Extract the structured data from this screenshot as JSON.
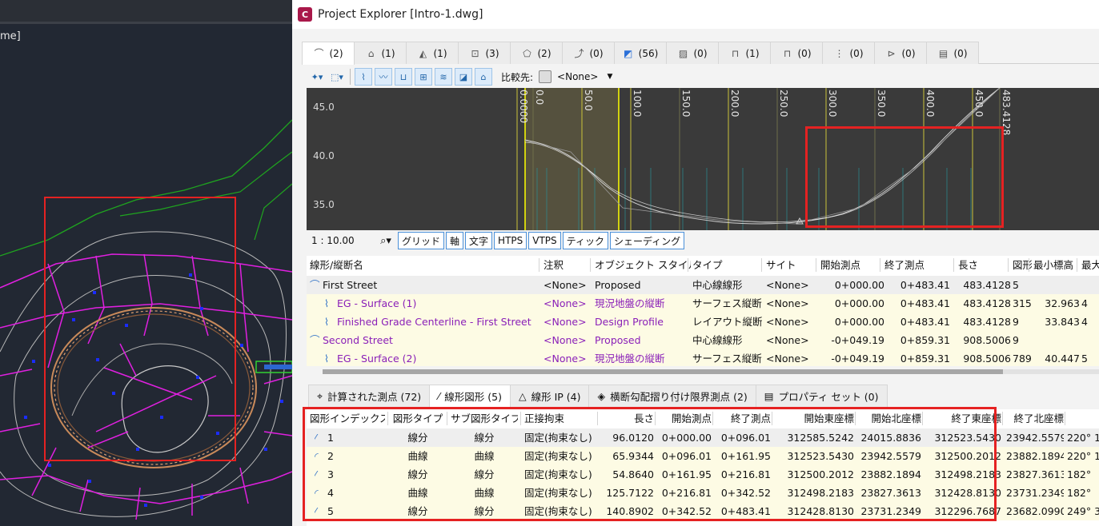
{
  "cad": {
    "tab_fragment": "me]"
  },
  "window": {
    "title": "Project Explorer [Intro-1.dwg]",
    "app_icon_letter": "C"
  },
  "object_tabs": [
    {
      "icon": "alignment-icon",
      "count": "(2)",
      "active": true
    },
    {
      "icon": "parcel-icon",
      "count": "(1)"
    },
    {
      "icon": "corridor-icon",
      "count": "(1)"
    },
    {
      "icon": "assembly-icon",
      "count": "(3)"
    },
    {
      "icon": "surface-icon",
      "count": "(2)"
    },
    {
      "icon": "feature-line-icon",
      "count": "(0)"
    },
    {
      "icon": "point-icon",
      "count": "(56)"
    },
    {
      "icon": "catchment-icon",
      "count": "(0)"
    },
    {
      "icon": "pipe-network-icon",
      "count": "(1)"
    },
    {
      "icon": "pressure-network-icon",
      "count": "(0)"
    },
    {
      "icon": "sample-line-icon",
      "count": "(0)"
    },
    {
      "icon": "view-frame-icon",
      "count": "(0)"
    },
    {
      "icon": "sheet-icon",
      "count": "(0)"
    }
  ],
  "toolbar": {
    "compare_label": "比較先:",
    "compare_value": "<None>"
  },
  "graph": {
    "y_ticks": [
      "45.0",
      "40.0",
      "35.0"
    ],
    "x_ticks": [
      "0.0000",
      "0.0",
      "50.0",
      "100.0",
      "150.0",
      "200.0",
      "250.0",
      "300.0",
      "350.0",
      "400.0",
      "450.0",
      "483.4128"
    ]
  },
  "graph_tools": {
    "scale": "1 : 10.00",
    "buttons": [
      "グリッド",
      "軸",
      "文字",
      "HTPS",
      "VTPS",
      "ティック",
      "シェーディング"
    ]
  },
  "alignment_grid": {
    "headers": [
      "線形/縦断名",
      "注釈",
      "オブジェクト スタイル",
      "タイプ",
      "サイト",
      "開始測点",
      "終了測点",
      "長さ",
      "図形",
      "最小標高",
      "最大"
    ],
    "rows": [
      [
        "First Street",
        "<None>",
        "Proposed",
        "中心線線形",
        "<None>",
        "0+000.00",
        "0+483.41",
        "483.4128",
        "5",
        "",
        ""
      ],
      [
        "EG - Surface (1)",
        "<None>",
        "現況地盤の縦断",
        "サーフェス縦断",
        "<None>",
        "0+000.00",
        "0+483.41",
        "483.4128",
        "315",
        "32.963",
        "4"
      ],
      [
        "Finished Grade Centerline - First Street",
        "<None>",
        "Design Profile",
        "レイアウト縦断",
        "<None>",
        "0+000.00",
        "0+483.41",
        "483.4128",
        "9",
        "33.843",
        "4"
      ],
      [
        "Second Street",
        "<None>",
        "Proposed",
        "中心線線形",
        "<None>",
        "-0+049.19",
        "0+859.31",
        "908.5006",
        "9",
        "",
        ""
      ],
      [
        "EG - Surface (2)",
        "<None>",
        "現況地盤の縦断",
        "サーフェス縦断",
        "<None>",
        "-0+049.19",
        "0+859.31",
        "908.5006",
        "789",
        "40.447",
        "5"
      ]
    ]
  },
  "bottom_tabs": [
    {
      "icon": "computed-station-icon",
      "label": "計算された測点 (72)"
    },
    {
      "icon": "segment-icon",
      "label": "線形図形 (5)",
      "active": true
    },
    {
      "icon": "pi-icon",
      "label": "線形 IP (4)"
    },
    {
      "icon": "superelevation-icon",
      "label": "横断勾配摺り付け限界測点 (2)"
    },
    {
      "icon": "property-set-icon",
      "label": "プロパティ セット (0)"
    }
  ],
  "segment_grid": {
    "headers": [
      "図形インデックス",
      "図形タイプ",
      "サブ図形タイプ",
      "正接拘束",
      "長さ",
      "開始測点",
      "終了測点",
      "開始東座標",
      "開始北座標",
      "終了東座標",
      "終了北座標",
      ""
    ],
    "rows": [
      [
        "1",
        "線分",
        "線分",
        "固定(拘束なし)",
        "96.0120",
        "0+000.00",
        "0+096.01",
        "312585.5242",
        "24015.8836",
        "312523.5430",
        "23942.5579",
        "220° 1"
      ],
      [
        "2",
        "曲線",
        "曲線",
        "固定(拘束なし)",
        "65.9344",
        "0+096.01",
        "0+161.95",
        "312523.5430",
        "23942.5579",
        "312500.2012",
        "23882.1894",
        "220° 1"
      ],
      [
        "3",
        "線分",
        "線分",
        "固定(拘束なし)",
        "54.8640",
        "0+161.95",
        "0+216.81",
        "312500.2012",
        "23882.1894",
        "312498.2183",
        "23827.3613",
        "182°"
      ],
      [
        "4",
        "曲線",
        "曲線",
        "固定(拘束なし)",
        "125.7122",
        "0+216.81",
        "0+342.52",
        "312498.2183",
        "23827.3613",
        "312428.8130",
        "23731.2349",
        "182°"
      ],
      [
        "5",
        "線分",
        "線分",
        "固定(拘束なし)",
        "140.8902",
        "0+342.52",
        "0+483.41",
        "312428.8130",
        "23731.2349",
        "312296.7687",
        "23682.0990",
        "249° 3"
      ]
    ]
  },
  "colors": {
    "highlight_box": "#e52222",
    "purple_text": "#8a1fb8",
    "cad_magenta": "#e020e0",
    "cad_green": "#1fa51f"
  }
}
